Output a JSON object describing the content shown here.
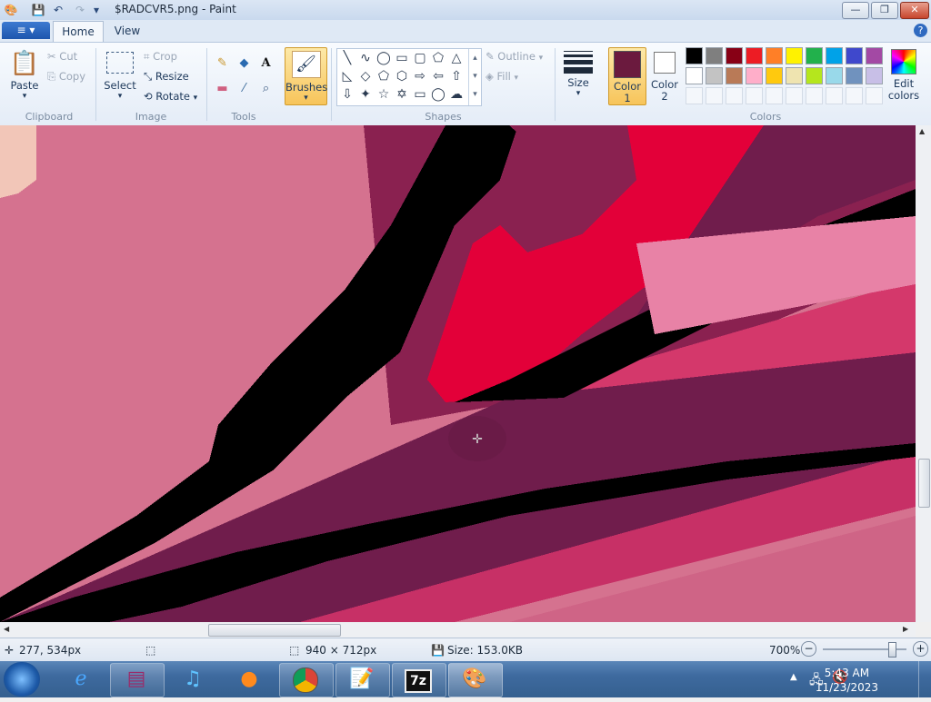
{
  "window": {
    "title": "$RADCVR5.png - Paint",
    "buttons": {
      "minimize": "—",
      "maximize": "❐",
      "close": "✕"
    }
  },
  "quick_access": {
    "paint_icon": "paint-icon",
    "save": "💾",
    "undo": "↶",
    "redo": "↷",
    "customize": "▾"
  },
  "tabs": {
    "file": "≡ ▾",
    "home": "Home",
    "view": "View",
    "help": "?"
  },
  "ribbon": {
    "clipboard": {
      "paste": "Paste",
      "cut": "Cut",
      "copy": "Copy",
      "label": "Clipboard"
    },
    "image": {
      "select": "Select",
      "crop": "Crop",
      "resize": "Resize",
      "rotate": "Rotate",
      "label": "Image"
    },
    "tools": {
      "label": "Tools"
    },
    "brushes": {
      "label": "Brushes"
    },
    "shapes": {
      "outline": "Outline",
      "fill": "Fill",
      "label": "Shapes"
    },
    "size": {
      "label": "Size"
    },
    "color1": {
      "line1": "Color",
      "line2": "1",
      "value": "#6b1a3e"
    },
    "color2": {
      "line1": "Color",
      "line2": "2",
      "value": "#ffffff"
    },
    "colors": {
      "label": "Colors",
      "row1": [
        "#000000",
        "#7f7f7f",
        "#880015",
        "#ed1c24",
        "#ff7f27",
        "#fff200",
        "#22b14c",
        "#00a2e8",
        "#3f48cc",
        "#a349a4"
      ],
      "row2": [
        "#ffffff",
        "#c3c3c3",
        "#b97a57",
        "#ffaec9",
        "#ffc90e",
        "#efe4b0",
        "#b5e61d",
        "#99d9ea",
        "#7092be",
        "#c8bfe7"
      ]
    },
    "edit_colors": {
      "line1": "Edit",
      "line2": "colors"
    }
  },
  "status": {
    "cursor_pos": "277, 534px",
    "image_size": "940 × 712px",
    "file_size": "Size: 153.0KB",
    "zoom": "700%",
    "zoom_level_percent": 700
  },
  "taskbar": {
    "time": "5:43 AM",
    "date": "11/23/2023",
    "apps": [
      "start-orb-icon",
      "internet-explorer-icon",
      "winrar-icon",
      "itunes-icon",
      "firefox-icon",
      "chrome-icon",
      "notepad-icon",
      "7zip-icon",
      "paint-icon"
    ]
  }
}
